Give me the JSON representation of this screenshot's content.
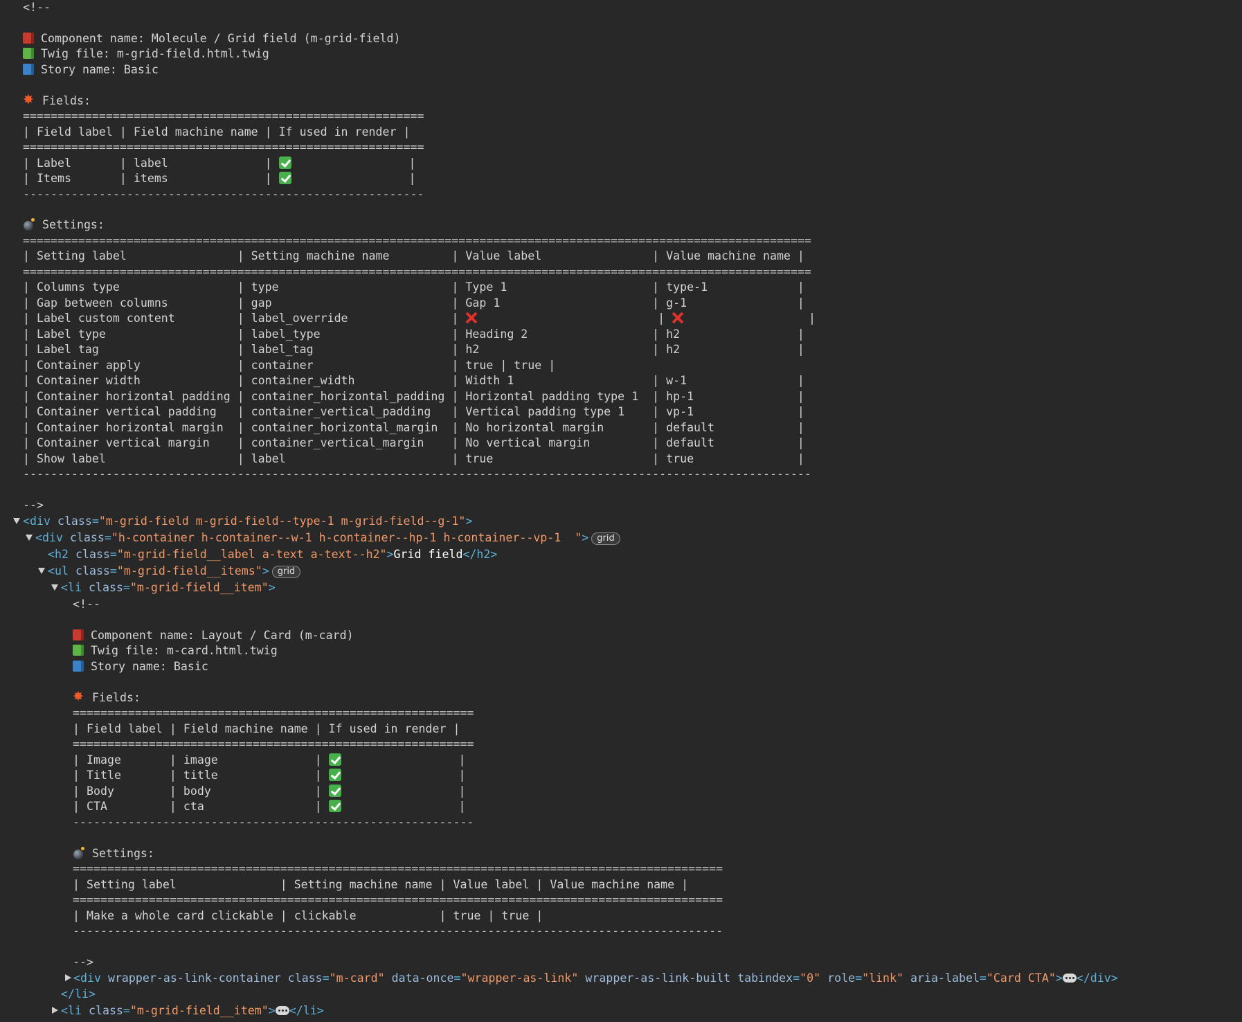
{
  "comment_open": "<!--",
  "comment_close": "-->",
  "grid_field": {
    "component_line": "Component name: Molecule / Grid field (m-grid-field)",
    "twig_line": "Twig file: m-grid-field.html.twig",
    "story_line": "Story name: Basic",
    "fields_heading": "Fields:",
    "fields_rule": "==========================================================",
    "fields_header": "| Field label | Field machine name | If used in render |",
    "fields_rows": [
      {
        "pre": "| Label       | label              | ",
        "post": "                 |"
      },
      {
        "pre": "| Items       | items              | ",
        "post": "                 |"
      }
    ],
    "fields_end": "----------------------------------------------------------",
    "settings_heading": "Settings:",
    "settings_rule": "==================================================================================================================",
    "settings_header": "| Setting label                | Setting machine name         | Value label                | Value machine name |",
    "settings_rows": [
      "| Columns type                 | type                         | Type 1                     | type-1             |",
      "| Gap between columns          | gap                          | Gap 1                      | g-1                |",
      "| Label type                   | label_type                   | Heading 2                  | h2                 |",
      "| Label tag                    | label_tag                    | h2                         | h2                 |",
      "| Container apply              | container                    | true | true |",
      "| Container width              | container_width              | Width 1                    | w-1                |",
      "| Container horizontal padding | container_horizontal_padding | Horizontal padding type 1  | hp-1               |",
      "| Container vertical padding   | container_vertical_padding   | Vertical padding type 1    | vp-1               |",
      "| Container horizontal margin  | container_horizontal_margin  | No horizontal margin       | default            |",
      "| Container vertical margin    | container_vertical_margin    | No vertical margin         | default            |",
      "| Show label                   | label                        | true                       | true               |"
    ],
    "override_row_a": "| Label custom content         | label_override               | ",
    "override_row_b": "                          | ",
    "override_row_c": "                  |",
    "settings_end": "------------------------------------------------------------------------------------------------------------------"
  },
  "dom": {
    "div1_open": "<div ",
    "div1_attr": "class",
    "div1_val": "\"m-grid-field m-grid-field--type-1 m-grid-field--g-1\"",
    "gt": ">",
    "div2_open": "<div ",
    "div2_attr": "class",
    "div2_val": "\"h-container h-container--w-1 h-container--hp-1 h-container--vp-1  \"",
    "badge_grid": "grid",
    "h2_open": "<h2 ",
    "h2_attr": "class",
    "h2_val": "\"m-grid-field__label a-text a-text--h2\"",
    "h2_text": "Grid field",
    "h2_close": "</h2>",
    "ul_open": "<ul ",
    "ul_attr": "class",
    "ul_val": "\"m-grid-field__items\"",
    "li_open": "<li ",
    "li_attr": "class",
    "li_val": "\"m-grid-field__item\"",
    "li_close": "</li>",
    "div_close": "</div>",
    "card_div_open": "<div ",
    "card_attrs": [
      {
        "name": "wrapper-as-link-container",
        "value": ""
      },
      {
        "name": "class",
        "value": "\"m-card\""
      },
      {
        "name": "data-once",
        "value": "\"wrapper-as-link\""
      },
      {
        "name": "wrapper-as-link-built",
        "value": ""
      },
      {
        "name": "tabindex",
        "value": "\"0\""
      },
      {
        "name": "role",
        "value": "\"link\""
      },
      {
        "name": "aria-label",
        "value": "\"Card CTA\""
      }
    ]
  },
  "card": {
    "component_line": "Component name: Layout / Card (m-card)",
    "twig_line": "Twig file: m-card.html.twig",
    "story_line": "Story name: Basic",
    "fields_heading": "Fields:",
    "fields_rule": "==========================================================",
    "fields_header": "| Field label | Field machine name | If used in render |",
    "fields_rows": [
      {
        "pre": "| Image       | image              | ",
        "post": "                 |"
      },
      {
        "pre": "| Title       | title              | ",
        "post": "                 |"
      },
      {
        "pre": "| Body        | body               | ",
        "post": "                 |"
      },
      {
        "pre": "| CTA         | cta                | ",
        "post": "                 |"
      }
    ],
    "fields_end": "----------------------------------------------------------",
    "settings_heading": "Settings:",
    "settings_rule": "==============================================================================================",
    "settings_header": "| Setting label               | Setting machine name | Value label | Value machine name |",
    "settings_rows": [
      "| Make a whole card clickable | clickable            | true | true |"
    ],
    "settings_end": "----------------------------------------------------------------------------------------------"
  },
  "icons": {
    "component": "red-book-icon",
    "twig": "green-book-icon",
    "story": "blue-book-icon",
    "fields": "collision-icon",
    "settings": "bomb-icon",
    "used": "check-mark-icon",
    "unused": "cross-mark-icon"
  }
}
